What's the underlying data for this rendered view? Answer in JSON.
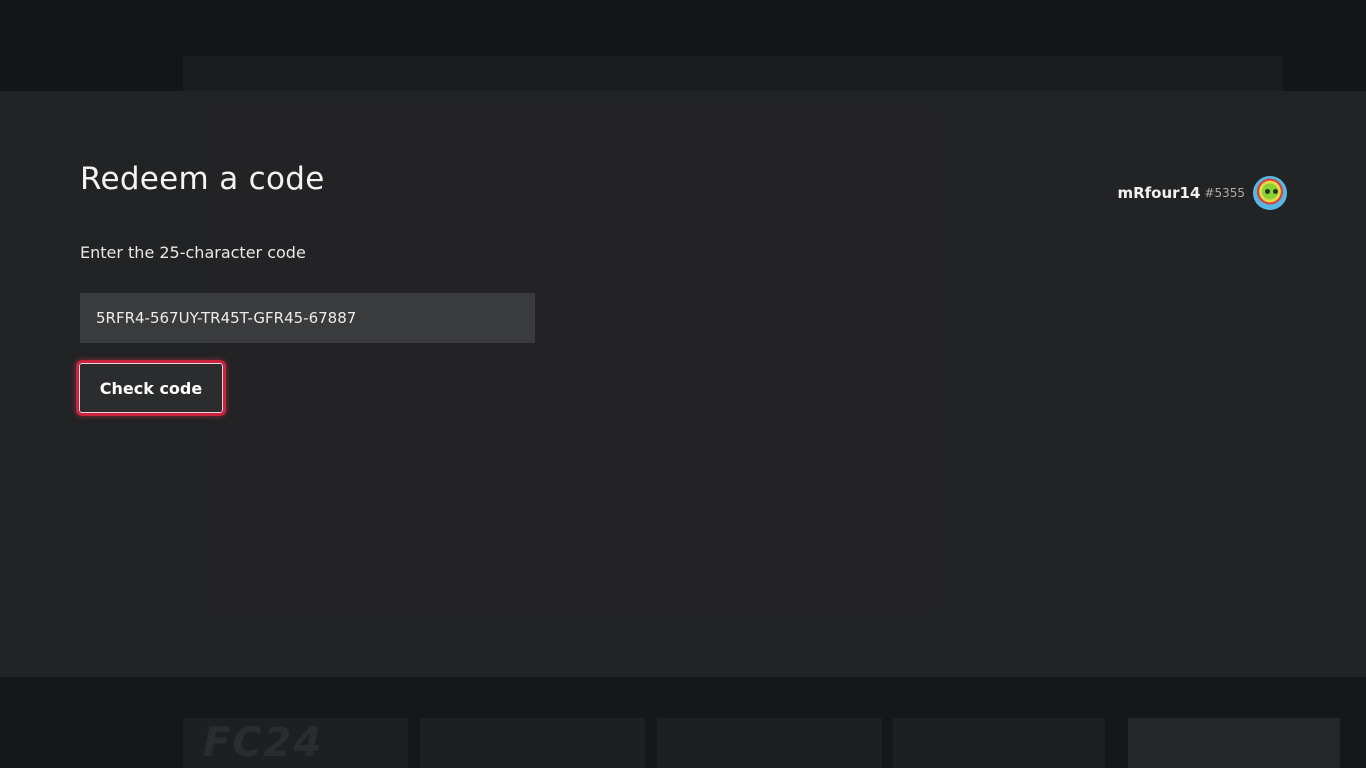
{
  "dialog": {
    "title": "Redeem a code",
    "instruction": "Enter the 25-character code",
    "code_value": "5RFR4-567UY-TR45T-GFR45-67887",
    "check_button_label": "Check code"
  },
  "user": {
    "gamertag": "mRfour14",
    "suffix": "#5355",
    "avatar_icon": "avatar-icon"
  },
  "colors": {
    "focus_outline": "#c8243f",
    "panel_background": "#222324",
    "input_background": "#3a3b3d"
  }
}
